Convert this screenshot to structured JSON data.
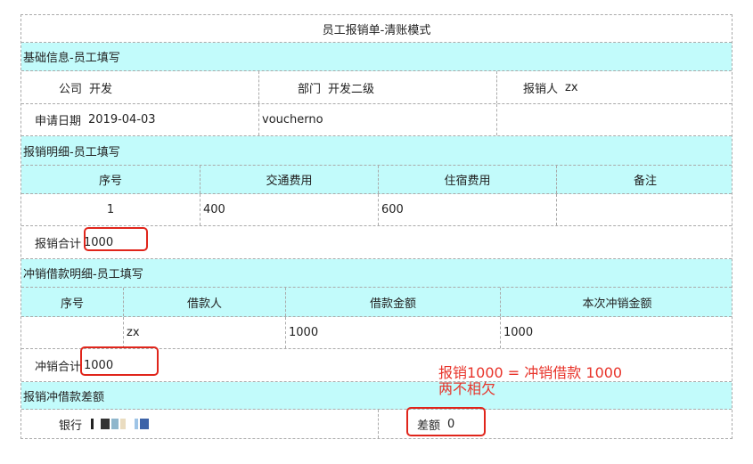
{
  "title": "员工报销单-清账模式",
  "basic": {
    "section": "基础信息-员工填写",
    "company_label": "公司",
    "company_value": "开发",
    "dept_label": "部门",
    "dept_value": "开发二级",
    "claimant_label": "报销人",
    "claimant_value": "zx",
    "date_label": "申请日期",
    "date_value": "2019-04-03",
    "voucher": "voucherno"
  },
  "detail": {
    "section": "报销明细-员工填写",
    "headers": [
      "序号",
      "交通费用",
      "住宿费用",
      "备注"
    ],
    "rows": [
      [
        "1",
        "400",
        "600",
        ""
      ]
    ],
    "total_label": "报销合计",
    "total_value": "1000"
  },
  "loan": {
    "section": "冲销借款明细-员工填写",
    "headers": [
      "序号",
      "借款人",
      "借款金额",
      "本次冲销金额"
    ],
    "rows": [
      [
        "",
        "zx",
        "1000",
        "1000"
      ]
    ],
    "total_label": "冲销合计",
    "total_value": "1000"
  },
  "diff": {
    "section": "报销冲借款差额",
    "bank_label": "银行",
    "diff_label": "差额",
    "diff_value": "0"
  },
  "annotation": {
    "line1": "报销1000 = 冲销借款 1000",
    "line2": "两不相欠"
  },
  "colors": {
    "header_bg": "#c2fbfb",
    "annotation": "#e8332a",
    "border": "#aaaaaa"
  }
}
